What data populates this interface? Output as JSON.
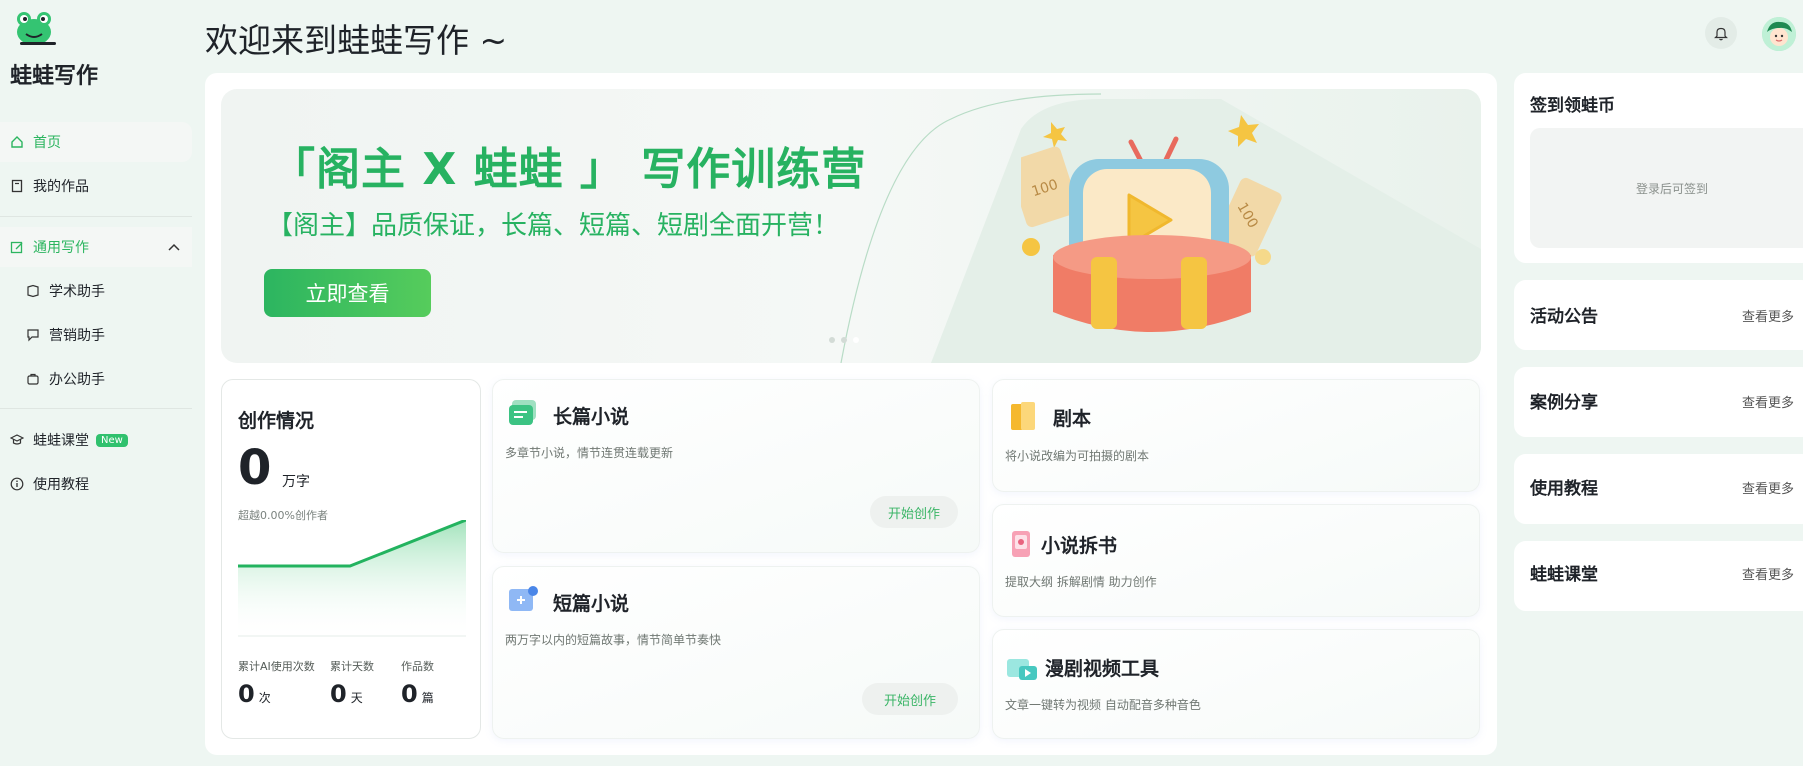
{
  "sidebar": {
    "brand": "蛙蛙写作",
    "items": [
      {
        "label": "首页"
      },
      {
        "label": "我的作品"
      },
      {
        "label": "通用写作"
      },
      {
        "label": "学术助手"
      },
      {
        "label": "营销助手"
      },
      {
        "label": "办公助手"
      },
      {
        "label": "蛙蛙课堂",
        "badge": "New"
      },
      {
        "label": "使用教程"
      }
    ]
  },
  "header": {
    "welcome": "欢迎来到蛙蛙写作 ~"
  },
  "banner": {
    "title": "「阁主 X 蛙蛙 」 写作训练营",
    "subtitle": "【阁主】品质保证，长篇、短篇、短剧全面开营！",
    "button": "立即查看",
    "coupon_label": "100",
    "accent": "#27b261"
  },
  "stats": {
    "title": "创作情况",
    "words": "0",
    "words_unit": "万字",
    "exceed": "超越0.00%创作者",
    "ai_uses_label": "累计AI使用次数",
    "ai_uses": "0",
    "ai_uses_unit": "次",
    "days_label": "累计天数",
    "days": "0",
    "days_unit": "天",
    "works_label": "作品数",
    "works": "0",
    "works_unit": "篇"
  },
  "features": {
    "long_novel": {
      "title": "长篇小说",
      "desc": "多章节小说，情节连贯连载更新",
      "button": "开始创作"
    },
    "short_novel": {
      "title": "短篇小说",
      "desc": "两万字以内的短篇故事，情节简单节奏快",
      "button": "开始创作"
    },
    "script": {
      "title": "剧本",
      "desc": "将小说改编为可拍摄的剧本"
    },
    "breakdown": {
      "title": "小说拆书",
      "desc": "提取大纲 拆解剧情 助力创作"
    },
    "comic_video": {
      "title": "漫剧视频工具",
      "desc": "文章一键转为视频 自动配音多种音色"
    }
  },
  "right": {
    "checkin_title": "签到领蛙币",
    "checkin_hint": "登录后可签到",
    "more_label": "查看更多",
    "sections": [
      {
        "title": "活动公告"
      },
      {
        "title": "案例分享"
      },
      {
        "title": "使用教程"
      },
      {
        "title": "蛙蛙课堂"
      }
    ]
  },
  "icons": [
    "frog-logo-icon",
    "home-icon",
    "book-icon",
    "edit-icon",
    "chevron-up-icon",
    "academic-icon",
    "marketing-icon",
    "office-icon",
    "graduation-cap-icon",
    "info-icon",
    "bell-icon",
    "avatar"
  ]
}
